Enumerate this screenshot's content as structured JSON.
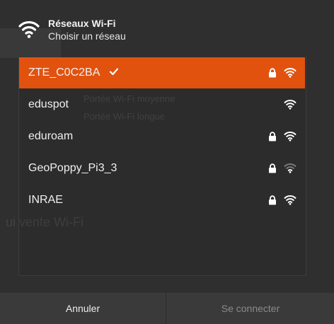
{
  "dialog": {
    "title": "Réseaux Wi-Fi",
    "subtitle": "Choisir un réseau"
  },
  "networks": [
    {
      "ssid": "ZTE_C0C2BA",
      "selected": true,
      "secured": true,
      "signal_bars": 3
    },
    {
      "ssid": "eduspot",
      "selected": false,
      "secured": false,
      "signal_bars": 3
    },
    {
      "ssid": "eduroam",
      "selected": false,
      "secured": true,
      "signal_bars": 3
    },
    {
      "ssid": "GeoPoppy_Pi3_3",
      "selected": false,
      "secured": true,
      "signal_bars": 1
    },
    {
      "ssid": "INRAE",
      "selected": false,
      "secured": true,
      "signal_bars": 3
    }
  ],
  "buttons": {
    "cancel": "Annuler",
    "connect": "Se connecter"
  },
  "background_text": {
    "item1": "Portée Wi-Fi moyenne",
    "item2": "Portée Wi-Fi longue",
    "heading": "ui vente Wi-Fi"
  },
  "colors": {
    "accent": "#e1520f",
    "background": "#2f2f2f"
  }
}
